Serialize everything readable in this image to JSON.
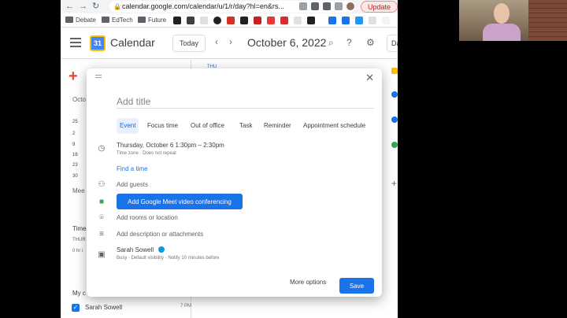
{
  "browser": {
    "url": "calendar.google.com/calendar/u/1/r/day?hl=en&rs...",
    "update_label": "Update"
  },
  "bookmarks": [
    "Debate",
    "EdTech",
    "Future"
  ],
  "header": {
    "app_title": "Calendar",
    "today_label": "Today",
    "date_title": "October 6, 2022",
    "view_label": "Da"
  },
  "sidebar": {
    "month_label": "Octo",
    "week_nums": [
      "25",
      "2",
      "9",
      "16",
      "23",
      "30"
    ],
    "meet_label": "Mee",
    "time_label": "Time",
    "thursday_label": "THUR",
    "hours_label": "0 hr i",
    "my_cal_label": "My c",
    "calendar_name": "Sarah Sowell",
    "time_7pm": "7 PM"
  },
  "grid": {
    "day_label": "THU"
  },
  "dialog": {
    "title_placeholder": "Add title",
    "tabs": [
      "Event",
      "Focus time",
      "Out of office",
      "Task",
      "Reminder",
      "Appointment schedule"
    ],
    "date_line": "Thursday, October 6    1:30pm  –  2:30pm",
    "tz_line": "Time zone · Does not repeat",
    "find_time": "Find a time",
    "guests": "Add guests",
    "meet_button": "Add Google Meet video conferencing",
    "rooms": "Add rooms or location",
    "description": "Add description or attachments",
    "owner": "Sarah Sowell",
    "busy_line": "Busy · Default visibility · Notify 10 minutes before",
    "more_options": "More options",
    "save": "Save"
  }
}
